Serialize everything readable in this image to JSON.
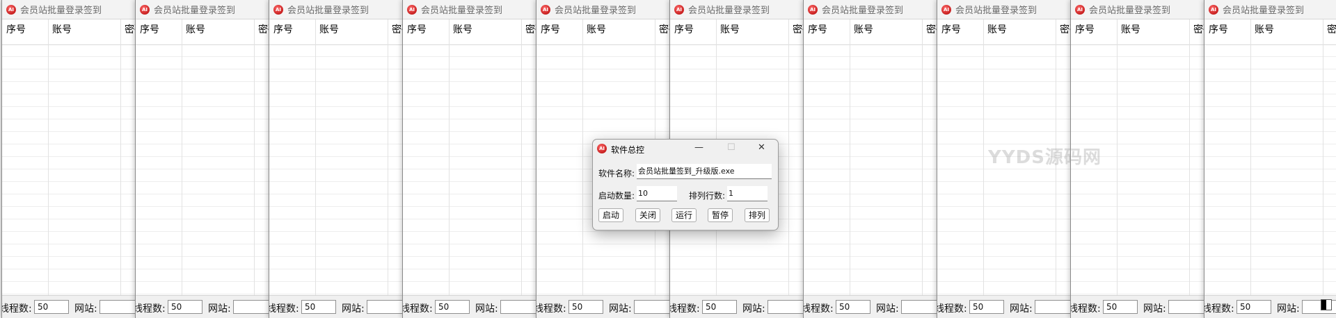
{
  "windows": [
    {
      "title": "会员站批量登录签到",
      "columns": [
        "序号",
        "账号",
        "密码"
      ],
      "footer": {
        "threads_label": "线程数:",
        "threads_value": "50",
        "site_label": "网站:",
        "site_value": ""
      }
    },
    {
      "title": "会员站批量登录签到",
      "columns": [
        "序号",
        "账号",
        "密码"
      ],
      "footer": {
        "threads_label": "线程数:",
        "threads_value": "50",
        "site_label": "网站:",
        "site_value": ""
      }
    },
    {
      "title": "会员站批量登录签到",
      "columns": [
        "序号",
        "账号",
        "密码"
      ],
      "footer": {
        "threads_label": "线程数:",
        "threads_value": "50",
        "site_label": "网站:",
        "site_value": ""
      }
    },
    {
      "title": "会员站批量登录签到",
      "columns": [
        "序号",
        "账号",
        "密码"
      ],
      "footer": {
        "threads_label": "线程数:",
        "threads_value": "50",
        "site_label": "网站:",
        "site_value": ""
      }
    },
    {
      "title": "会员站批量登录签到",
      "columns": [
        "序号",
        "账号",
        "密码"
      ],
      "footer": {
        "threads_label": "线程数:",
        "threads_value": "50",
        "site_label": "网站:",
        "site_value": ""
      }
    },
    {
      "title": "会员站批量登录签到",
      "columns": [
        "序号",
        "账号",
        "密码"
      ],
      "footer": {
        "threads_label": "线程数:",
        "threads_value": "50",
        "site_label": "网站:",
        "site_value": ""
      }
    },
    {
      "title": "会员站批量登录签到",
      "columns": [
        "序号",
        "账号",
        "密码"
      ],
      "footer": {
        "threads_label": "线程数:",
        "threads_value": "50",
        "site_label": "网站:",
        "site_value": ""
      }
    },
    {
      "title": "会员站批量登录签到",
      "columns": [
        "序号",
        "账号",
        "密码"
      ],
      "footer": {
        "threads_label": "线程数:",
        "threads_value": "50",
        "site_label": "网站:",
        "site_value": ""
      }
    },
    {
      "title": "会员站批量登录签到",
      "columns": [
        "序号",
        "账号",
        "密码"
      ],
      "footer": {
        "threads_label": "线程数:",
        "threads_value": "50",
        "site_label": "网站:",
        "site_value": ""
      }
    },
    {
      "title": "会员站批量登录签到",
      "columns": [
        "序号",
        "账号",
        "密码"
      ],
      "footer": {
        "threads_label": "线程数:",
        "threads_value": "50",
        "site_label": "网站:",
        "site_value": ""
      }
    }
  ],
  "app_icon_glyph": "AI",
  "dialog": {
    "title": "软件总控",
    "caption_buttons": {
      "minimize": "—",
      "maximize": "☐",
      "close": "✕"
    },
    "software_name_label": "软件名称:",
    "software_name_value": "会员站批量签到_升级版.exe",
    "launch_count_label": "启动数量:",
    "launch_count_value": "10",
    "rows_label": "排列行数:",
    "rows_value": "1",
    "buttons": [
      "启动",
      "关闭",
      "运行",
      "暂停",
      "排列"
    ]
  },
  "watermark": "YYDS源码网",
  "colors": {
    "app_icon": "#c8102e",
    "title_text": "#6b6b6b",
    "window_bg": "#ffffff",
    "chrome": "#f0f0f0"
  }
}
